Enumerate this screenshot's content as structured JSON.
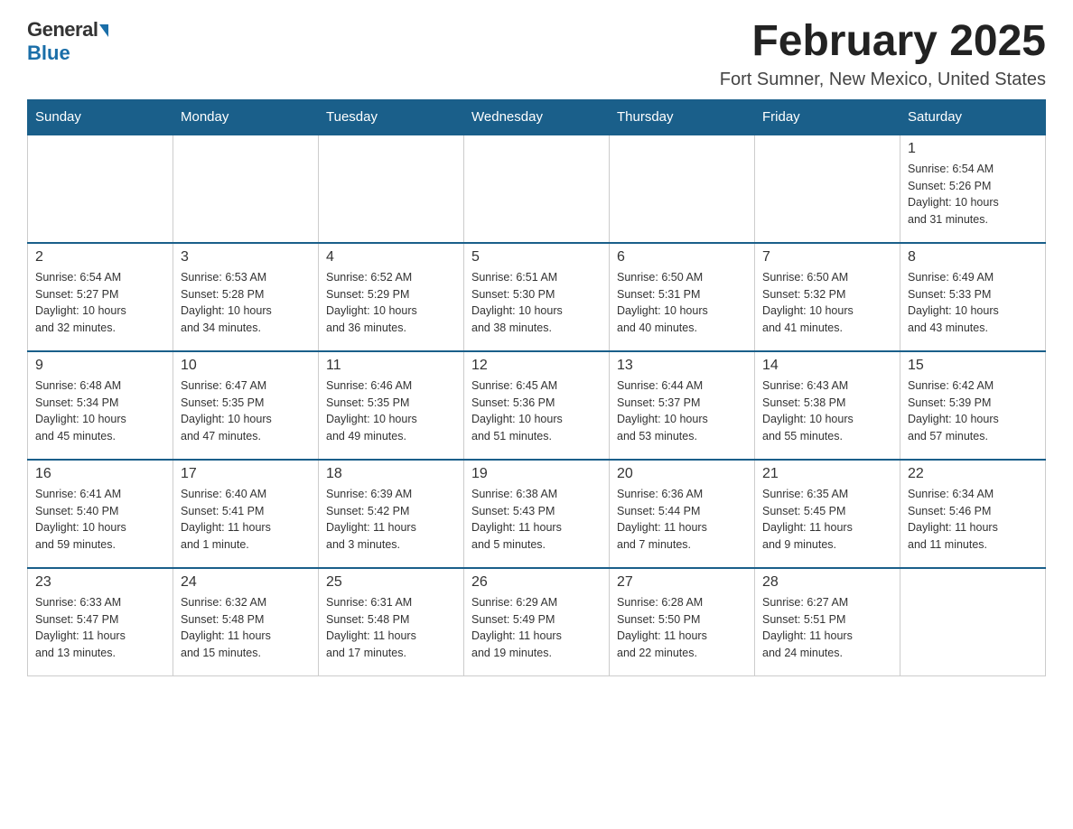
{
  "header": {
    "logo_general": "General",
    "logo_blue": "Blue",
    "title": "February 2025",
    "subtitle": "Fort Sumner, New Mexico, United States"
  },
  "days_of_week": [
    "Sunday",
    "Monday",
    "Tuesday",
    "Wednesday",
    "Thursday",
    "Friday",
    "Saturday"
  ],
  "weeks": [
    [
      {
        "day": "",
        "info": ""
      },
      {
        "day": "",
        "info": ""
      },
      {
        "day": "",
        "info": ""
      },
      {
        "day": "",
        "info": ""
      },
      {
        "day": "",
        "info": ""
      },
      {
        "day": "",
        "info": ""
      },
      {
        "day": "1",
        "info": "Sunrise: 6:54 AM\nSunset: 5:26 PM\nDaylight: 10 hours\nand 31 minutes."
      }
    ],
    [
      {
        "day": "2",
        "info": "Sunrise: 6:54 AM\nSunset: 5:27 PM\nDaylight: 10 hours\nand 32 minutes."
      },
      {
        "day": "3",
        "info": "Sunrise: 6:53 AM\nSunset: 5:28 PM\nDaylight: 10 hours\nand 34 minutes."
      },
      {
        "day": "4",
        "info": "Sunrise: 6:52 AM\nSunset: 5:29 PM\nDaylight: 10 hours\nand 36 minutes."
      },
      {
        "day": "5",
        "info": "Sunrise: 6:51 AM\nSunset: 5:30 PM\nDaylight: 10 hours\nand 38 minutes."
      },
      {
        "day": "6",
        "info": "Sunrise: 6:50 AM\nSunset: 5:31 PM\nDaylight: 10 hours\nand 40 minutes."
      },
      {
        "day": "7",
        "info": "Sunrise: 6:50 AM\nSunset: 5:32 PM\nDaylight: 10 hours\nand 41 minutes."
      },
      {
        "day": "8",
        "info": "Sunrise: 6:49 AM\nSunset: 5:33 PM\nDaylight: 10 hours\nand 43 minutes."
      }
    ],
    [
      {
        "day": "9",
        "info": "Sunrise: 6:48 AM\nSunset: 5:34 PM\nDaylight: 10 hours\nand 45 minutes."
      },
      {
        "day": "10",
        "info": "Sunrise: 6:47 AM\nSunset: 5:35 PM\nDaylight: 10 hours\nand 47 minutes."
      },
      {
        "day": "11",
        "info": "Sunrise: 6:46 AM\nSunset: 5:35 PM\nDaylight: 10 hours\nand 49 minutes."
      },
      {
        "day": "12",
        "info": "Sunrise: 6:45 AM\nSunset: 5:36 PM\nDaylight: 10 hours\nand 51 minutes."
      },
      {
        "day": "13",
        "info": "Sunrise: 6:44 AM\nSunset: 5:37 PM\nDaylight: 10 hours\nand 53 minutes."
      },
      {
        "day": "14",
        "info": "Sunrise: 6:43 AM\nSunset: 5:38 PM\nDaylight: 10 hours\nand 55 minutes."
      },
      {
        "day": "15",
        "info": "Sunrise: 6:42 AM\nSunset: 5:39 PM\nDaylight: 10 hours\nand 57 minutes."
      }
    ],
    [
      {
        "day": "16",
        "info": "Sunrise: 6:41 AM\nSunset: 5:40 PM\nDaylight: 10 hours\nand 59 minutes."
      },
      {
        "day": "17",
        "info": "Sunrise: 6:40 AM\nSunset: 5:41 PM\nDaylight: 11 hours\nand 1 minute."
      },
      {
        "day": "18",
        "info": "Sunrise: 6:39 AM\nSunset: 5:42 PM\nDaylight: 11 hours\nand 3 minutes."
      },
      {
        "day": "19",
        "info": "Sunrise: 6:38 AM\nSunset: 5:43 PM\nDaylight: 11 hours\nand 5 minutes."
      },
      {
        "day": "20",
        "info": "Sunrise: 6:36 AM\nSunset: 5:44 PM\nDaylight: 11 hours\nand 7 minutes."
      },
      {
        "day": "21",
        "info": "Sunrise: 6:35 AM\nSunset: 5:45 PM\nDaylight: 11 hours\nand 9 minutes."
      },
      {
        "day": "22",
        "info": "Sunrise: 6:34 AM\nSunset: 5:46 PM\nDaylight: 11 hours\nand 11 minutes."
      }
    ],
    [
      {
        "day": "23",
        "info": "Sunrise: 6:33 AM\nSunset: 5:47 PM\nDaylight: 11 hours\nand 13 minutes."
      },
      {
        "day": "24",
        "info": "Sunrise: 6:32 AM\nSunset: 5:48 PM\nDaylight: 11 hours\nand 15 minutes."
      },
      {
        "day": "25",
        "info": "Sunrise: 6:31 AM\nSunset: 5:48 PM\nDaylight: 11 hours\nand 17 minutes."
      },
      {
        "day": "26",
        "info": "Sunrise: 6:29 AM\nSunset: 5:49 PM\nDaylight: 11 hours\nand 19 minutes."
      },
      {
        "day": "27",
        "info": "Sunrise: 6:28 AM\nSunset: 5:50 PM\nDaylight: 11 hours\nand 22 minutes."
      },
      {
        "day": "28",
        "info": "Sunrise: 6:27 AM\nSunset: 5:51 PM\nDaylight: 11 hours\nand 24 minutes."
      },
      {
        "day": "",
        "info": ""
      }
    ]
  ]
}
